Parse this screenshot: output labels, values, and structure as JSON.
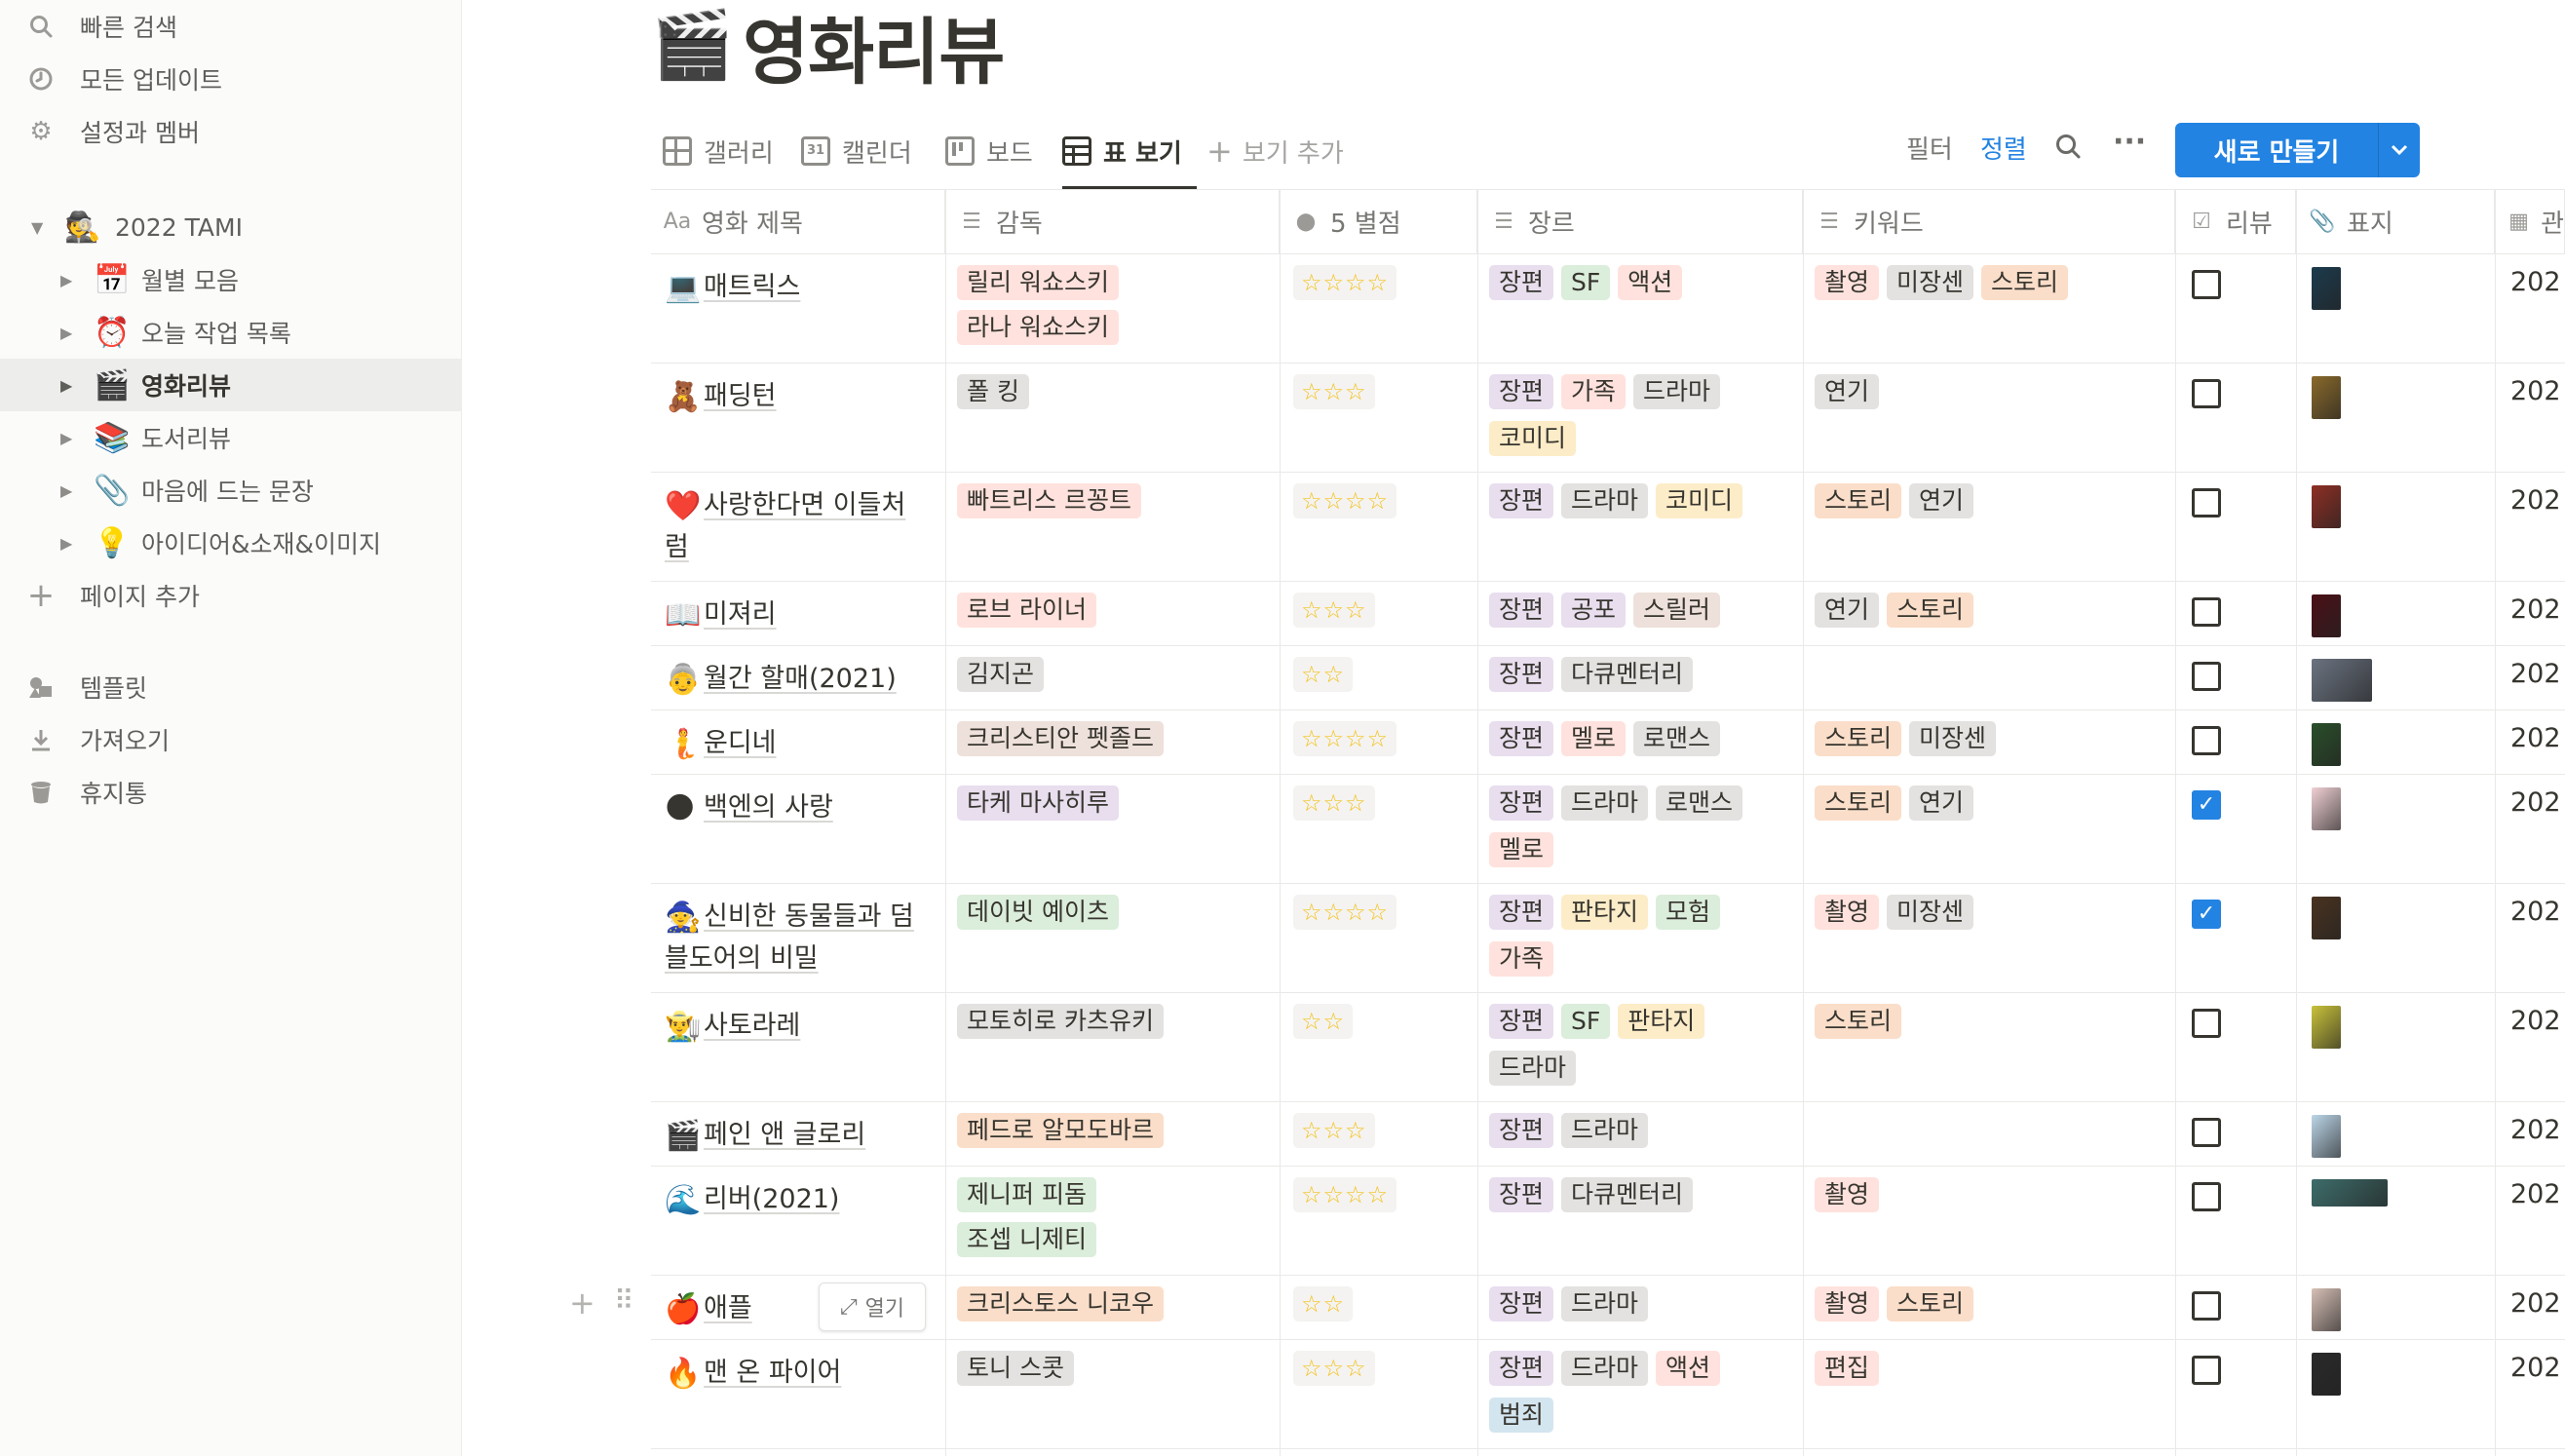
{
  "sidebar": {
    "top_items": [
      {
        "label": "빠른 검색",
        "icon": "search-icon"
      },
      {
        "label": "모든 업데이트",
        "icon": "clock-icon"
      },
      {
        "label": "설정과 멤버",
        "icon": "gear-icon"
      }
    ],
    "workspace": {
      "label": "2022 TAMI",
      "emoji": "🕵"
    },
    "pages": [
      {
        "label": "월별 모음",
        "emoji": "📅"
      },
      {
        "label": "오늘 작업 목록",
        "emoji": "⏰"
      },
      {
        "label": "영화리뷰",
        "emoji": "🎬",
        "selected": true
      },
      {
        "label": "도서리뷰",
        "emoji": "📚"
      },
      {
        "label": "마음에 드는 문장",
        "emoji": "📎"
      },
      {
        "label": "아이디어&소재&이미지",
        "emoji": "💡"
      }
    ],
    "add_page": "페이지 추가",
    "bottom_items": [
      {
        "label": "템플릿",
        "icon": "shapes-icon"
      },
      {
        "label": "가져오기",
        "icon": "download-icon"
      },
      {
        "label": "휴지통",
        "icon": "trash-icon"
      }
    ]
  },
  "page": {
    "emoji": "🎬",
    "title": "영화리뷰"
  },
  "views": {
    "tabs": [
      {
        "label": "갤러리",
        "icon": "gallery-icon"
      },
      {
        "label": "캘린더",
        "icon": "calendar-icon"
      },
      {
        "label": "보드",
        "icon": "board-icon"
      },
      {
        "label": "표 보기",
        "icon": "table-icon",
        "active": true
      }
    ],
    "add_view": "보기 추가"
  },
  "toolbar": {
    "filter": "필터",
    "sort": "정렬",
    "new_button": "새로 만들기"
  },
  "table": {
    "columns": [
      "영화 제목",
      "감독",
      "5 별점",
      "장르",
      "키워드",
      "리뷰",
      "표지",
      "관"
    ],
    "open_label": "열기",
    "rows": [
      {
        "emoji": "💻",
        "title": "매트릭스",
        "directors": [
          "릴리 워쇼스키",
          "라나 워쇼스키"
        ],
        "stars": 4,
        "genres": [
          "장편",
          "SF",
          "액션"
        ],
        "keywords": [
          "촬영",
          "미장센",
          "스토리"
        ],
        "review": false,
        "date": "202"
      },
      {
        "emoji": "🧸",
        "title": "패딩턴",
        "directors": [
          "폴 킹"
        ],
        "stars": 3,
        "genres": [
          "장편",
          "가족",
          "드라마",
          "코미디"
        ],
        "keywords": [
          "연기"
        ],
        "review": false,
        "date": "202"
      },
      {
        "emoji": "❤️",
        "title": "사랑한다면 이들처럼",
        "directors": [
          "빠트리스 르꽁트"
        ],
        "stars": 4,
        "genres": [
          "장편",
          "드라마",
          "코미디"
        ],
        "keywords": [
          "스토리",
          "연기"
        ],
        "review": false,
        "date": "202"
      },
      {
        "emoji": "📖",
        "title": "미져리",
        "directors": [
          "로브 라이너"
        ],
        "stars": 3,
        "genres": [
          "장편",
          "공포",
          "스릴러"
        ],
        "keywords": [
          "연기",
          "스토리"
        ],
        "review": false,
        "date": "202"
      },
      {
        "emoji": "👵",
        "title": "월간 할매(2021)",
        "directors": [
          "김지곤"
        ],
        "stars": 2,
        "genres": [
          "장편",
          "다큐멘터리"
        ],
        "keywords": [],
        "review": false,
        "date": "202"
      },
      {
        "emoji": "🧜",
        "title": "운디네",
        "directors": [
          "크리스티안 펫졸드"
        ],
        "stars": 4,
        "genres": [
          "장편",
          "멜로",
          "로맨스"
        ],
        "keywords": [
          "스토리",
          "미장센"
        ],
        "review": false,
        "date": "202"
      },
      {
        "emoji": "🌑",
        "title": "백엔의 사랑",
        "directors": [
          "타케 마사히루"
        ],
        "stars": 3,
        "genres": [
          "장편",
          "드라마",
          "로맨스",
          "멜로"
        ],
        "keywords": [
          "스토리",
          "연기"
        ],
        "review": true,
        "date": "202"
      },
      {
        "emoji": "🧙",
        "title": "신비한 동물들과 덤블도어의 비밀",
        "directors": [
          "데이빗 예이츠"
        ],
        "stars": 4,
        "genres": [
          "장편",
          "판타지",
          "모험",
          "가족"
        ],
        "keywords": [
          "촬영",
          "미장센"
        ],
        "review": true,
        "date": "202"
      },
      {
        "emoji": "👨‍🌾",
        "title": "사토라레",
        "directors": [
          "모토히로 카츠유키"
        ],
        "stars": 2,
        "genres": [
          "장편",
          "SF",
          "판타지",
          "드라마"
        ],
        "keywords": [
          "스토리"
        ],
        "review": false,
        "date": "202"
      },
      {
        "emoji": "🎬",
        "title": "페인 앤 글로리",
        "directors": [
          "페드로 알모도바르"
        ],
        "stars": 3,
        "genres": [
          "장편",
          "드라마"
        ],
        "keywords": [],
        "review": false,
        "date": "202"
      },
      {
        "emoji": "🌊",
        "title": "리버(2021)",
        "directors": [
          "제니퍼 피돔",
          "조셉 니제티"
        ],
        "stars": 4,
        "genres": [
          "장편",
          "다큐멘터리"
        ],
        "keywords": [
          "촬영"
        ],
        "review": false,
        "date": "202"
      },
      {
        "emoji": "🍎",
        "title": "애플",
        "directors": [
          "크리스토스 니코우"
        ],
        "stars": 2,
        "genres": [
          "장편",
          "드라마"
        ],
        "keywords": [
          "촬영",
          "스토리"
        ],
        "review": false,
        "date": "202"
      },
      {
        "emoji": "🔥",
        "title": "맨 온 파이어",
        "directors": [
          "토니 스콧"
        ],
        "stars": 3,
        "genres": [
          "장편",
          "드라마",
          "액션",
          "범죄"
        ],
        "keywords": [
          "편집"
        ],
        "review": false,
        "date": "202"
      }
    ]
  },
  "tag_colors": {
    "purple": "#e8deee",
    "green": "#dbeddb",
    "red": "#ffe2dd",
    "gray": "#e3e2e0",
    "orange": "#fadec9",
    "yellow": "#fdecc8",
    "blue": "#d3e5ef",
    "brown": "#eee0da",
    "pink": "#f5e0e9"
  },
  "accent_color": "#2383e2"
}
